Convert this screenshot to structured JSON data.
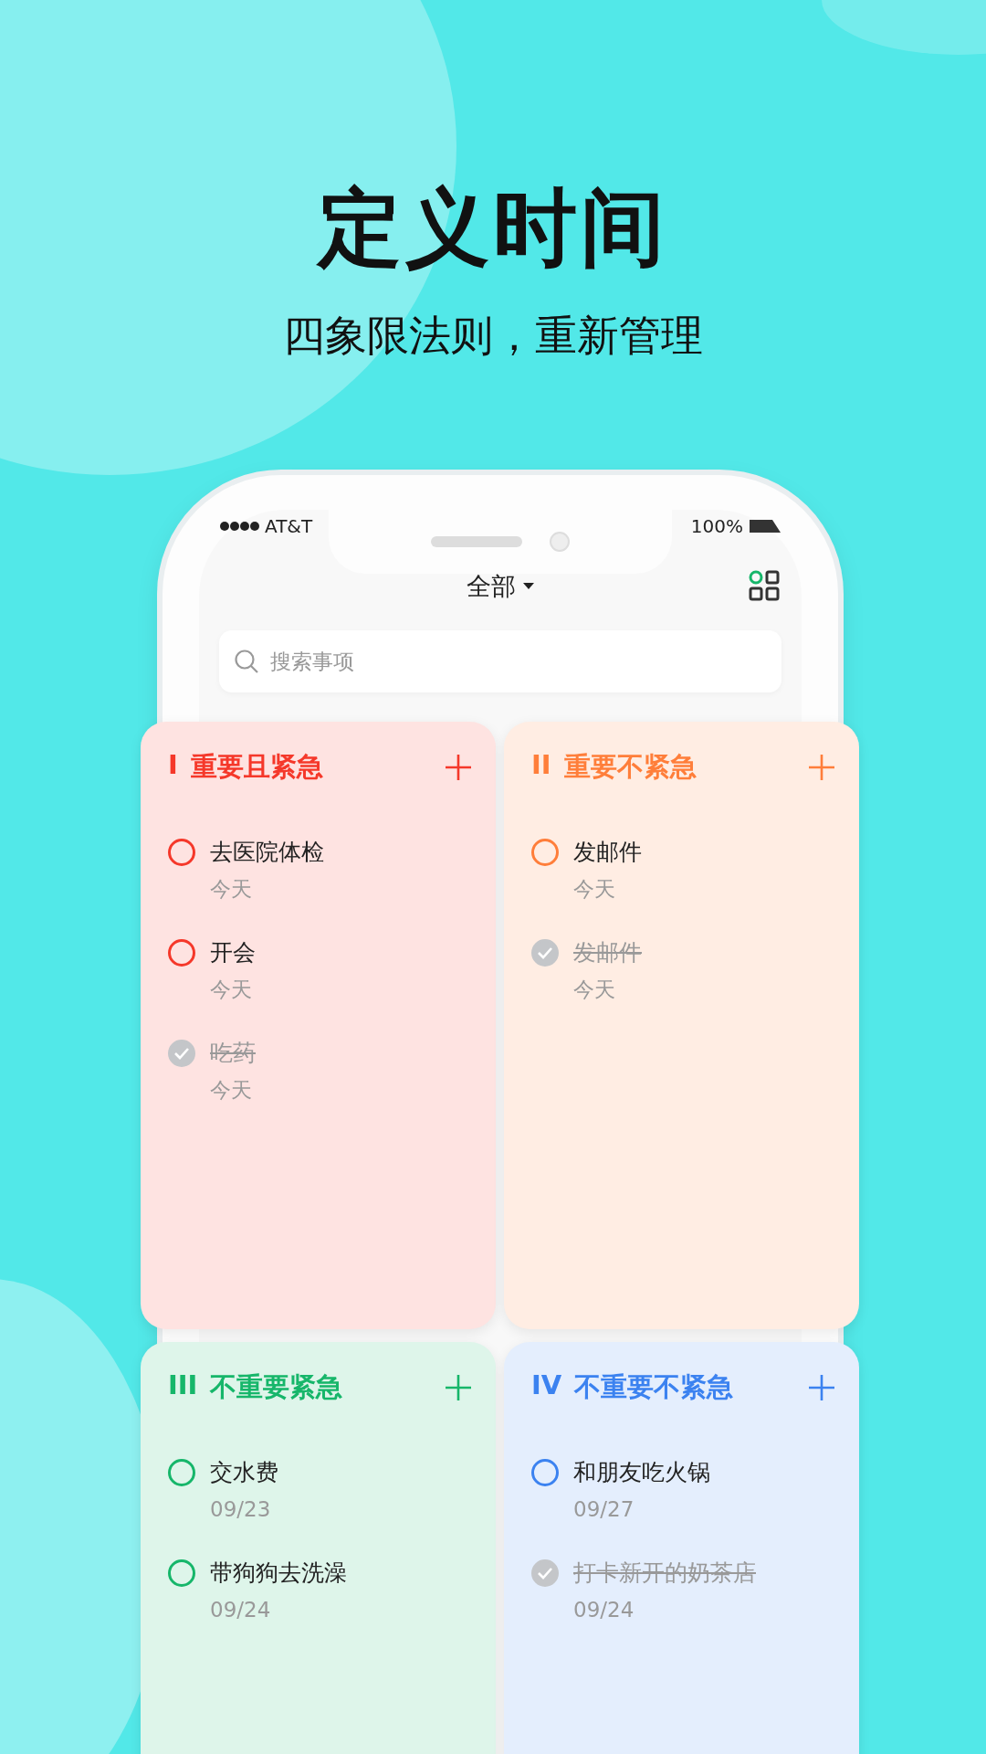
{
  "headline": "定义时间",
  "subtitle": "四象限法则，重新管理",
  "status_bar": {
    "carrier": "AT&T",
    "battery": "100%"
  },
  "nav": {
    "title": "全部"
  },
  "search": {
    "placeholder": "搜索事项"
  },
  "quadrants": [
    {
      "numeral": "I",
      "title": "重要且紧急",
      "color": "#f5382a",
      "items": [
        {
          "text": "去医院体检",
          "date": "今天",
          "done": false
        },
        {
          "text": "开会",
          "date": "今天",
          "done": false
        },
        {
          "text": "吃药",
          "date": "今天",
          "done": true
        }
      ]
    },
    {
      "numeral": "II",
      "title": "重要不紧急",
      "color": "#ff7e3a",
      "items": [
        {
          "text": "发邮件",
          "date": "今天",
          "done": false
        },
        {
          "text": "发邮件",
          "date": "今天",
          "done": true
        }
      ]
    },
    {
      "numeral": "III",
      "title": "不重要紧急",
      "color": "#16b66a",
      "items": [
        {
          "text": "交水费",
          "date": "09/23",
          "done": false
        },
        {
          "text": "带狗狗去洗澡",
          "date": "09/24",
          "done": false
        }
      ]
    },
    {
      "numeral": "IV",
      "title": "不重要不紧急",
      "color": "#3b82f0",
      "items": [
        {
          "text": "和朋友吃火锅",
          "date": "09/27",
          "done": false
        },
        {
          "text": "打卡新开的奶茶店",
          "date": "09/24",
          "done": true
        }
      ]
    }
  ]
}
